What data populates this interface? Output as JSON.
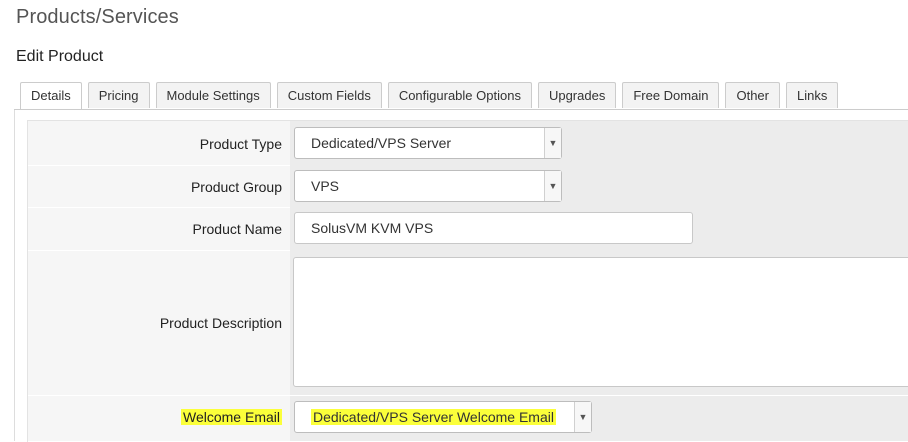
{
  "page": {
    "title": "Products/Services",
    "section": "Edit Product"
  },
  "tabs": [
    {
      "label": "Details",
      "active": true
    },
    {
      "label": "Pricing"
    },
    {
      "label": "Module Settings"
    },
    {
      "label": "Custom Fields"
    },
    {
      "label": "Configurable Options"
    },
    {
      "label": "Upgrades"
    },
    {
      "label": "Free Domain"
    },
    {
      "label": "Other"
    },
    {
      "label": "Links"
    }
  ],
  "form": {
    "product_type": {
      "label": "Product Type",
      "value": "Dedicated/VPS Server"
    },
    "product_group": {
      "label": "Product Group",
      "value": "VPS"
    },
    "product_name": {
      "label": "Product Name",
      "value": "SolusVM KVM VPS"
    },
    "product_description": {
      "label": "Product Description",
      "value": ""
    },
    "welcome_email": {
      "label": "Welcome Email",
      "value": "Dedicated/VPS Server Welcome Email",
      "highlight_color": "#fbff3a"
    }
  },
  "icons": {
    "dropdown": "chevron-down-icon"
  }
}
